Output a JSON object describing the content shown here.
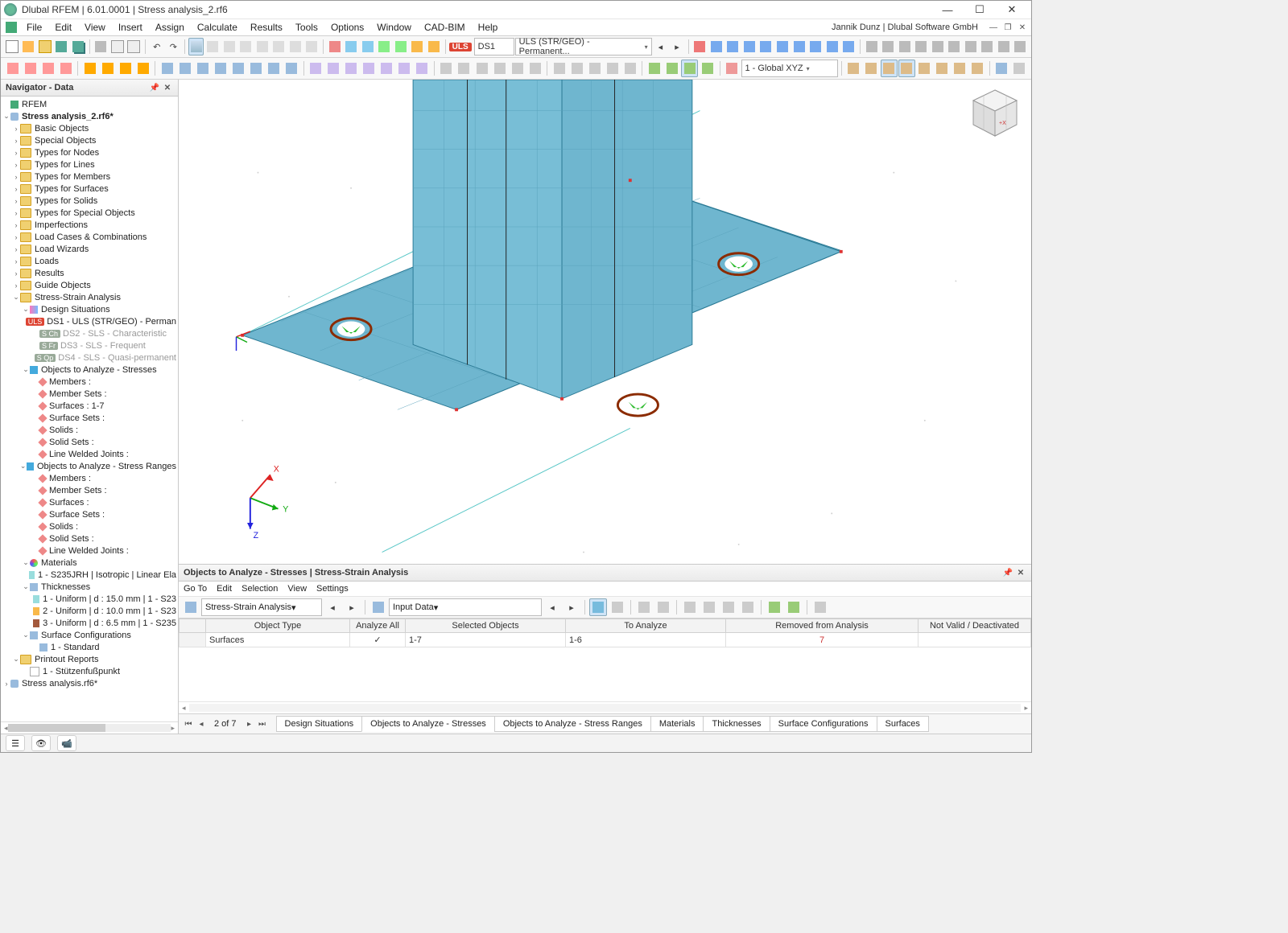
{
  "titlebar": {
    "title": "Dlubal RFEM | 6.01.0001 | Stress analysis_2.rf6"
  },
  "menubar": {
    "items": [
      "File",
      "Edit",
      "View",
      "Insert",
      "Assign",
      "Calculate",
      "Results",
      "Tools",
      "Options",
      "Window",
      "CAD-BIM",
      "Help"
    ],
    "userinfo": "Jannik Dunz | Dlubal Software GmbH"
  },
  "toolbar1": {
    "uls": "ULS",
    "ds_code": "DS1",
    "ds_name": "ULS (STR/GEO) - Permanent...",
    "coord": "1 - Global XYZ"
  },
  "navigator": {
    "title": "Navigator - Data",
    "root": "RFEM",
    "model": "Stress analysis_2.rf6*",
    "folders": [
      "Basic Objects",
      "Special Objects",
      "Types for Nodes",
      "Types for Lines",
      "Types for Members",
      "Types for Surfaces",
      "Types for Solids",
      "Types for Special Objects",
      "Imperfections",
      "Load Cases & Combinations",
      "Load Wizards",
      "Loads",
      "Results",
      "Guide Objects"
    ],
    "ssa": "Stress-Strain Analysis",
    "ds_node": "Design Situations",
    "ds": [
      {
        "badge": "ULS",
        "badgeClass": "uls",
        "text": "DS1 - ULS (STR/GEO) - Perman",
        "dim": false
      },
      {
        "badge": "S Ch",
        "badgeClass": "sch",
        "text": "DS2 - SLS - Characteristic",
        "dim": true
      },
      {
        "badge": "S Fr",
        "badgeClass": "sfr",
        "text": "DS3 - SLS - Frequent",
        "dim": true
      },
      {
        "badge": "S Qp",
        "badgeClass": "sqp",
        "text": "DS4 - SLS - Quasi-permanent",
        "dim": true
      }
    ],
    "obj_stresses": "Objects to Analyze - Stresses",
    "obj_stresses_items": [
      "Members :",
      "Member Sets :",
      "Surfaces : 1-7",
      "Surface Sets :",
      "Solids :",
      "Solid Sets :",
      "Line Welded Joints :"
    ],
    "obj_ranges": "Objects to Analyze - Stress Ranges",
    "obj_ranges_items": [
      "Members :",
      "Member Sets :",
      "Surfaces :",
      "Surface Sets :",
      "Solids :",
      "Solid Sets :",
      "Line Welded Joints :"
    ],
    "materials": "Materials",
    "materials_items": [
      "1 - S235JRH | Isotropic | Linear Ela"
    ],
    "thick": "Thicknesses",
    "thick_items": [
      "1 - Uniform | d : 15.0 mm | 1 - S23",
      "2 - Uniform | d : 10.0 mm | 1 - S23",
      "3 - Uniform | d : 6.5 mm | 1 - S235"
    ],
    "surf_cfg": "Surface Configurations",
    "surf_cfg_items": [
      "1 - Standard"
    ],
    "printout": "Printout Reports",
    "printout_items": [
      "1 - Stützenfußpunkt"
    ],
    "model2": "Stress analysis.rf6*"
  },
  "bottom": {
    "title": "Objects to Analyze - Stresses | Stress-Strain Analysis",
    "menu": [
      "Go To",
      "Edit",
      "Selection",
      "View",
      "Settings"
    ],
    "combo1": "Stress-Strain Analysis",
    "combo2": "Input Data",
    "headers": [
      "Object Type",
      "Analyze All",
      "Selected Objects",
      "To Analyze",
      "Removed from Analysis",
      "Not Valid / Deactivated"
    ],
    "row": {
      "type": "Surfaces",
      "analyze_all": "✓",
      "selected": "1-7",
      "to_analyze": "1-6",
      "removed": "7",
      "invalid": ""
    }
  },
  "tabs": {
    "page": "2 of 7",
    "items": [
      "Design Situations",
      "Objects to Analyze - Stresses",
      "Objects to Analyze - Stress Ranges",
      "Materials",
      "Thicknesses",
      "Surface Configurations",
      "Surfaces"
    ],
    "active": 1
  },
  "axes3d": {
    "x": "X",
    "y": "Y",
    "z": "Z"
  }
}
